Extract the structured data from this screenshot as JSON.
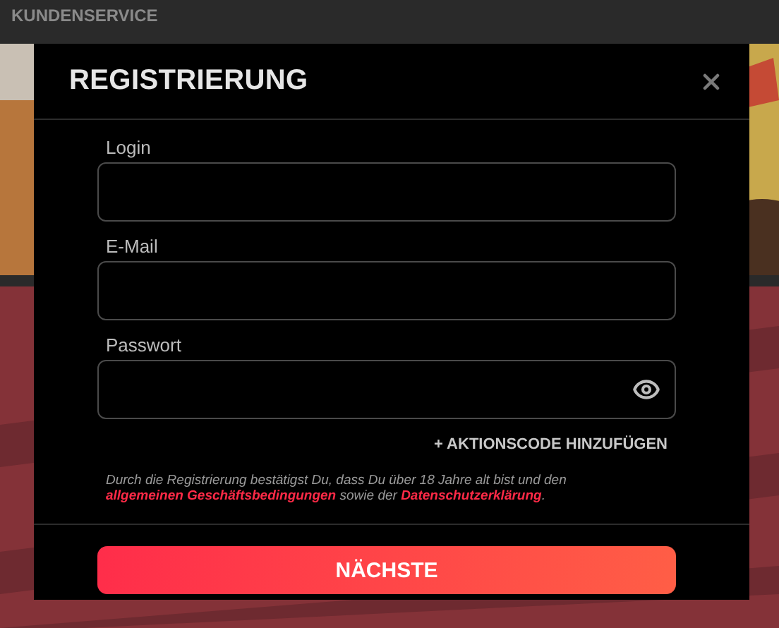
{
  "page": {
    "nav_item": "KUNDENSERVICE"
  },
  "dialog": {
    "title": "REGISTRIERUNG",
    "fields": [
      {
        "label": "Login",
        "kind": "text"
      },
      {
        "label": "E-Mail",
        "kind": "email"
      },
      {
        "label": "Passwort",
        "kind": "password"
      }
    ],
    "promo_link": "+ AKTIONSCODE HINZUFÜGEN",
    "terms": {
      "before": "Durch die Registrierung bestätigst Du, dass Du über 18 Jahre alt bist und den ",
      "link_1": "allgemeinen Geschäftsbedingungen",
      "middle": " sowie der ",
      "link_2": "Datenschutzerklärung",
      "end": "."
    },
    "submit": "NÄCHSTE"
  }
}
